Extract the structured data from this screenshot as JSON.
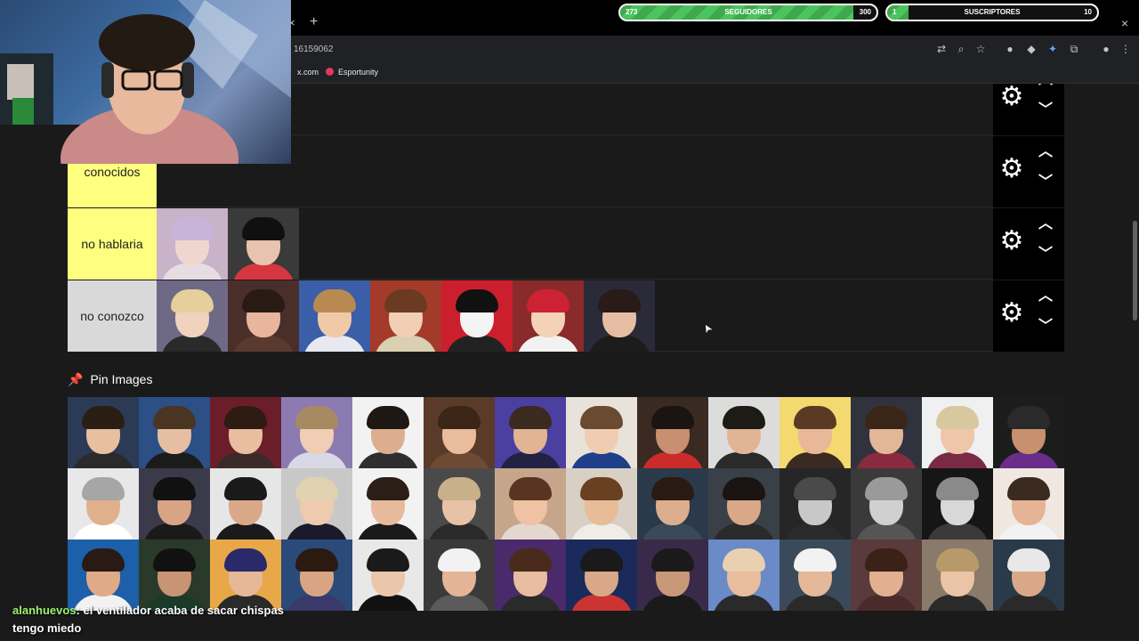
{
  "stream_bars": {
    "followers": {
      "label": "SEGUIDORES",
      "current": "273",
      "goal": "300",
      "progress": 0.91
    },
    "subscribers": {
      "label": "SUSCRIPTORES",
      "current": "1",
      "goal": "10",
      "progress": 0.1
    }
  },
  "browser": {
    "url_fragment": "16159062",
    "bookmarks": [
      {
        "label": "x.com",
        "icon": "x-icon"
      },
      {
        "label": "Esportunity",
        "icon": "esportunity-icon"
      }
    ],
    "close_glyph": "×",
    "new_tab_glyph": "+",
    "window_close_glyph": "×"
  },
  "tiers": [
    {
      "label": "",
      "color": "#1a1a1a",
      "items": []
    },
    {
      "label": "conocidos",
      "color": "#ffff7f",
      "items": []
    },
    {
      "label": "no hablaria",
      "color": "#ffff7f",
      "items": [
        {
          "bg": "#c9b3c9",
          "hair": "#c8b4d8",
          "skin": "#f1d6d0",
          "body": "#e6dde2"
        },
        {
          "bg": "#3a3a3a",
          "hair": "#101010",
          "skin": "#e8c4b0",
          "body": "#d6363f"
        }
      ]
    },
    {
      "label": "no conozco",
      "color": "#d9d9d9",
      "items": [
        {
          "bg": "#6e6a86",
          "hair": "#e6cf9a",
          "skin": "#f0d2bd",
          "body": "#2a2a2a"
        },
        {
          "bg": "#4a2e2a",
          "hair": "#2a1a14",
          "skin": "#e8b69c",
          "body": "#5a3a30"
        },
        {
          "bg": "#3a5ea8",
          "hair": "#b88a52",
          "skin": "#f0c9a8",
          "body": "#e8e8f0"
        },
        {
          "bg": "#a33a2a",
          "hair": "#6a3a22",
          "skin": "#f2cfb4",
          "body": "#d8d0b0"
        },
        {
          "bg": "#cc1f2e",
          "hair": "#111111",
          "skin": "#f4f4f4",
          "body": "#222222"
        },
        {
          "bg": "#8a2a2a",
          "hair": "#cc2233",
          "skin": "#f3d2b8",
          "body": "#f2f2f2"
        },
        {
          "bg": "#2a2a38",
          "hair": "#2a1a18",
          "skin": "#e6bda2",
          "body": "#1c1c1c"
        }
      ]
    }
  ],
  "controls": {
    "gear_glyph": "⚙",
    "up_glyph": "︿",
    "down_glyph": "﹀"
  },
  "pin_section": {
    "title": "Pin Images",
    "icon": "pushpin-icon",
    "icon_glyph": "📌"
  },
  "pin_images": [
    {
      "bg": "#2b3a55",
      "hair": "#2a1d14",
      "skin": "#e8c0a0",
      "body": "#2a2a2a"
    },
    {
      "bg": "#2c4f86",
      "hair": "#4a3422",
      "skin": "#e6bfa2",
      "body": "#1b1b1b"
    },
    {
      "bg": "#6b1e2a",
      "hair": "#2e1b12",
      "skin": "#e9bea0",
      "body": "#3c2a2a"
    },
    {
      "bg": "#8c7bb0",
      "hair": "#a88a62",
      "skin": "#f0cdb4",
      "body": "#d8d8e6"
    },
    {
      "bg": "#f2f2f2",
      "hair": "#1e1814",
      "skin": "#dcae8f",
      "body": "#2e2e2e"
    },
    {
      "bg": "#5a3a28",
      "hair": "#3a2516",
      "skin": "#e8bc9c",
      "body": "#6e4a34"
    },
    {
      "bg": "#4b3fa0",
      "hair": "#3b2a20",
      "skin": "#e2b494",
      "body": "#222244"
    },
    {
      "bg": "#e8e2da",
      "hair": "#6a4a30",
      "skin": "#f0cdb2",
      "body": "#1f3f8a"
    },
    {
      "bg": "#3a2a22",
      "hair": "#1a1412",
      "skin": "#c89070",
      "body": "#cc2b2b"
    },
    {
      "bg": "#dcdcdc",
      "hair": "#1e1a16",
      "skin": "#e2b496",
      "body": "#2a2a2a"
    },
    {
      "bg": "#f4d870",
      "hair": "#5a3a22",
      "skin": "#e8b898",
      "body": "#3a2a22"
    },
    {
      "bg": "#30333e",
      "hair": "#3a2616",
      "skin": "#e4b698",
      "body": "#8a2a3e"
    },
    {
      "bg": "#f0f0f0",
      "hair": "#d8c8a0",
      "skin": "#eec6aa",
      "body": "#7a2a44"
    },
    {
      "bg": "#1c1c1c",
      "hair": "#2a2a2a",
      "skin": "#c8906e",
      "body": "#6a2e8a"
    },
    {
      "bg": "#e8e8ea",
      "hair": "#a6a6a6",
      "skin": "#e0b08c",
      "body": "#ffffff"
    },
    {
      "bg": "#3a3a4a",
      "hair": "#111111",
      "skin": "#d8a484",
      "body": "#1a1a1a"
    },
    {
      "bg": "#e6e6e6",
      "hair": "#1a1a1a",
      "skin": "#d8a888",
      "body": "#1a1a1a"
    },
    {
      "bg": "#c8c8c8",
      "hair": "#e0d2b0",
      "skin": "#eecaae",
      "body": "#1a1a2a"
    },
    {
      "bg": "#f2f2f2",
      "hair": "#2a1e16",
      "skin": "#e6ba9a",
      "body": "#1a1a1a"
    },
    {
      "bg": "#4a4a4a",
      "hair": "#c8b08a",
      "skin": "#e8c2a6",
      "body": "#2a2a2a"
    },
    {
      "bg": "#c6a68a",
      "hair": "#5a3422",
      "skin": "#eec2a2",
      "body": "#e2d8d0"
    },
    {
      "bg": "#d8d0c4",
      "hair": "#6a4022",
      "skin": "#e8bc98",
      "body": "#f0ece6"
    },
    {
      "bg": "#2a3a4a",
      "hair": "#2a1a12",
      "skin": "#ddae8e",
      "body": "#3a4a5a"
    },
    {
      "bg": "#3a4048",
      "hair": "#1a1412",
      "skin": "#d8a888",
      "body": "#2a2a2a"
    },
    {
      "bg": "#262626",
      "hair": "#4a4a4a",
      "skin": "#c8c8c8",
      "body": "#2a2a2a"
    },
    {
      "bg": "#3a3a3a",
      "hair": "#9a9a9a",
      "skin": "#d0d0d0",
      "body": "#555555"
    },
    {
      "bg": "#161616",
      "hair": "#8a8a8a",
      "skin": "#d8d8d8",
      "body": "#3a3a3a"
    },
    {
      "bg": "#f0e8e0",
      "hair": "#3a2a20",
      "skin": "#e4b494",
      "body": "#f2f2f2"
    },
    {
      "bg": "#1d5fa8",
      "hair": "#2a1a14",
      "skin": "#e0aa88",
      "body": "#f2f2f2"
    },
    {
      "bg": "#2a3a2a",
      "hair": "#111111",
      "skin": "#c89474",
      "body": "#1a3a2a"
    },
    {
      "bg": "#e8a848",
      "hair": "#2a2a6a",
      "skin": "#e6b898",
      "body": "#2a2a2a"
    },
    {
      "bg": "#2a4a7a",
      "hair": "#2a1a10",
      "skin": "#d8a484",
      "body": "#3a3a6a"
    },
    {
      "bg": "#e8e8e8",
      "hair": "#1a1a1a",
      "skin": "#eac6aa",
      "body": "#111111"
    },
    {
      "bg": "#3a3a3a",
      "hair": "#f2f2f2",
      "skin": "#e4b496",
      "body": "#5a5a5a"
    },
    {
      "bg": "#4a2a6a",
      "hair": "#4a2a1a",
      "skin": "#e8bca0",
      "body": "#2a2a2a"
    },
    {
      "bg": "#1a2a5a",
      "hair": "#1a1a1a",
      "skin": "#d8a888",
      "body": "#cc3333"
    },
    {
      "bg": "#3a2a4a",
      "hair": "#1a1a1a",
      "skin": "#c89878",
      "body": "#1a1a1a"
    },
    {
      "bg": "#6a8ac8",
      "hair": "#e8d0b0",
      "skin": "#e8bc9c",
      "body": "#2a2a2a"
    },
    {
      "bg": "#3a4a5a",
      "hair": "#f2f2f2",
      "skin": "#e4b898",
      "body": "#2a2a2a"
    },
    {
      "bg": "#5a3a3a",
      "hair": "#3a2218",
      "skin": "#e2b090",
      "body": "#4a2a2a"
    },
    {
      "bg": "#8a7a6a",
      "hair": "#b89a6a",
      "skin": "#eac4a4",
      "body": "#2a2a2a"
    },
    {
      "bg": "#2a3a4a",
      "hair": "#e8e8e8",
      "skin": "#d8a888",
      "body": "#2a2a2a"
    }
  ],
  "cursor_glyph": "➤",
  "chat": {
    "user": "alanhuevos",
    "separator": ":",
    "message": " el ventilador acaba de sacar chispas tengo miedo"
  }
}
